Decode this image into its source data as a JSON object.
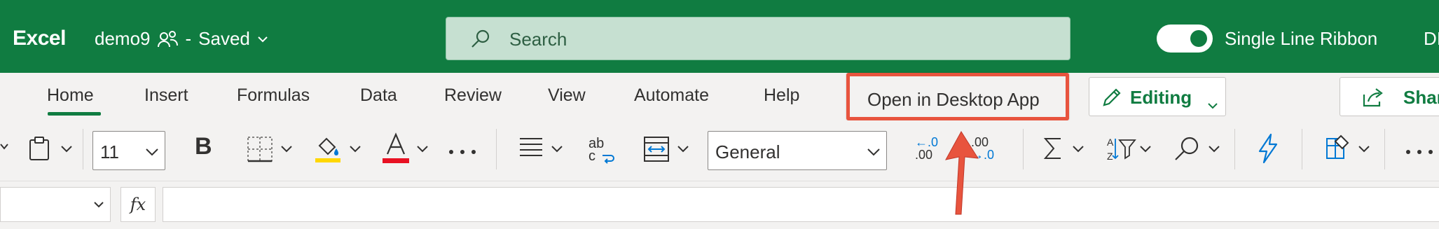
{
  "titlebar": {
    "app_name": "Excel",
    "doc_name": "demo9",
    "separator": "-",
    "save_status": "Saved",
    "search_placeholder": "Search",
    "single_line_ribbon_label": "Single Line Ribbon",
    "user_initials": "DI"
  },
  "tabs": [
    "Home",
    "Insert",
    "Formulas",
    "Data",
    "Review",
    "View",
    "Automate",
    "Help"
  ],
  "ribbon_actions": {
    "open_desktop": "Open in Desktop App",
    "editing": "Editing",
    "share": "Share"
  },
  "toolbar": {
    "font_size": "11",
    "bold": "B",
    "number_format": "General",
    "wrap_top": "ab",
    "wrap_bottom": "c",
    "dec_inc_top": "←.0",
    "dec_inc_bottom": ".00",
    "dec_dec_top": ".00",
    "dec_dec_bottom": "→.0",
    "font_color_letter": "A"
  },
  "formula_bar": {
    "fx_label": "fx",
    "formula_value": ""
  },
  "colors": {
    "brand_green": "#107c41",
    "highlight_yellow": "#ffd700",
    "font_red": "#e81123",
    "callout_red": "#e8543e"
  }
}
